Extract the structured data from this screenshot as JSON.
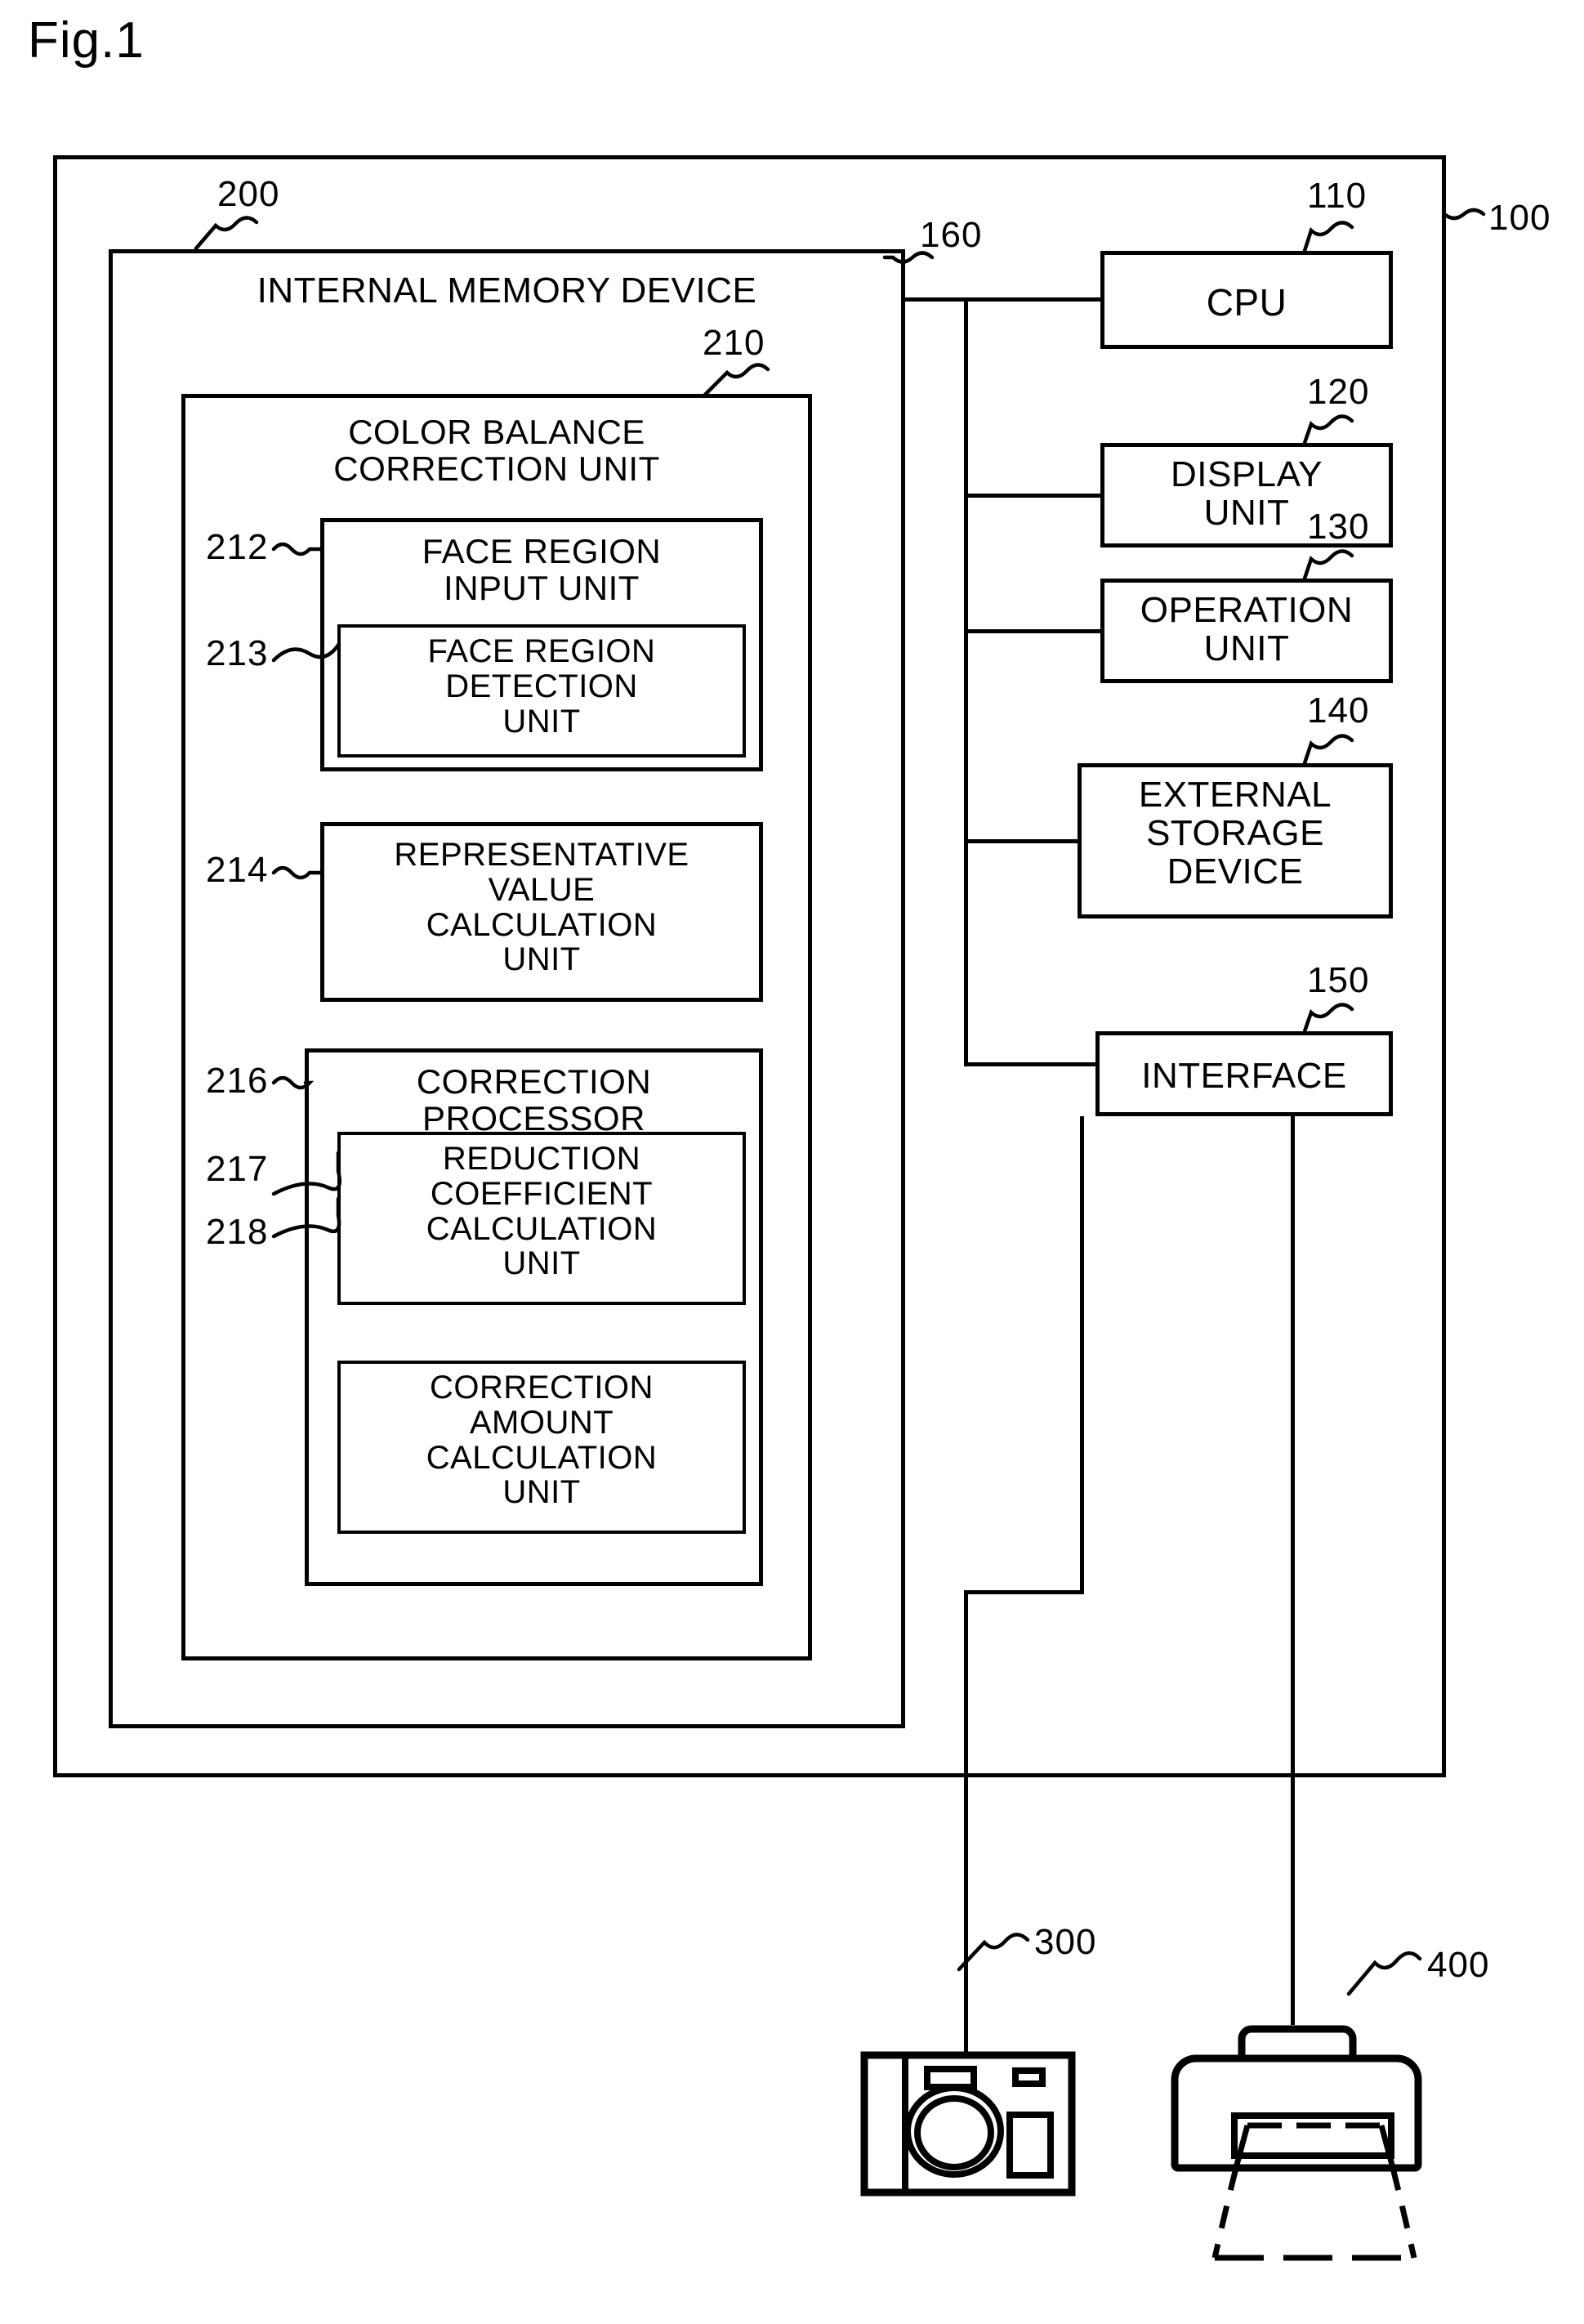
{
  "figure": {
    "title": "Fig.1",
    "type": "patent-block-diagram"
  },
  "system": {
    "ref": "100",
    "label": ""
  },
  "bus": {
    "ref": "160",
    "name": "bus-line"
  },
  "memory": {
    "ref": "200",
    "label": "INTERNAL MEMORY DEVICE"
  },
  "color_balance_unit": {
    "ref": "210",
    "label": "COLOR BALANCE\nCORRECTION UNIT"
  },
  "blocks": {
    "face_region_input": {
      "ref": "212",
      "label": "FACE REGION\nINPUT UNIT"
    },
    "face_region_detection": {
      "ref": "213",
      "label": "FACE REGION\nDETECTION\nUNIT"
    },
    "representative_value": {
      "ref": "214",
      "label": "REPRESENTATIVE\nVALUE\nCALCULATION\nUNIT"
    },
    "correction_processor": {
      "ref": "216",
      "label": "CORRECTION\nPROCESSOR"
    },
    "reduction_coefficient": {
      "ref": "217",
      "label": "REDUCTION\nCOEFFICIENT\nCALCULATION\nUNIT"
    },
    "correction_amount": {
      "ref": "218",
      "label": "CORRECTION\nAMOUNT\nCALCULATION\nUNIT"
    }
  },
  "peripherals": {
    "cpu": {
      "ref": "110",
      "label": "CPU"
    },
    "display_unit": {
      "ref": "120",
      "label": "DISPLAY\nUNIT"
    },
    "operation_unit": {
      "ref": "130",
      "label": "OPERATION\nUNIT"
    },
    "external_storage": {
      "ref": "140",
      "label": "EXTERNAL\nSTORAGE\nDEVICE"
    },
    "interface": {
      "ref": "150",
      "label": "INTERFACE"
    }
  },
  "external_devices": {
    "camera": {
      "ref": "300",
      "icon": "digital-camera-icon"
    },
    "printer": {
      "ref": "400",
      "icon": "printer-icon"
    }
  },
  "colors": {
    "ink": "#000000",
    "paper": "#ffffff"
  }
}
